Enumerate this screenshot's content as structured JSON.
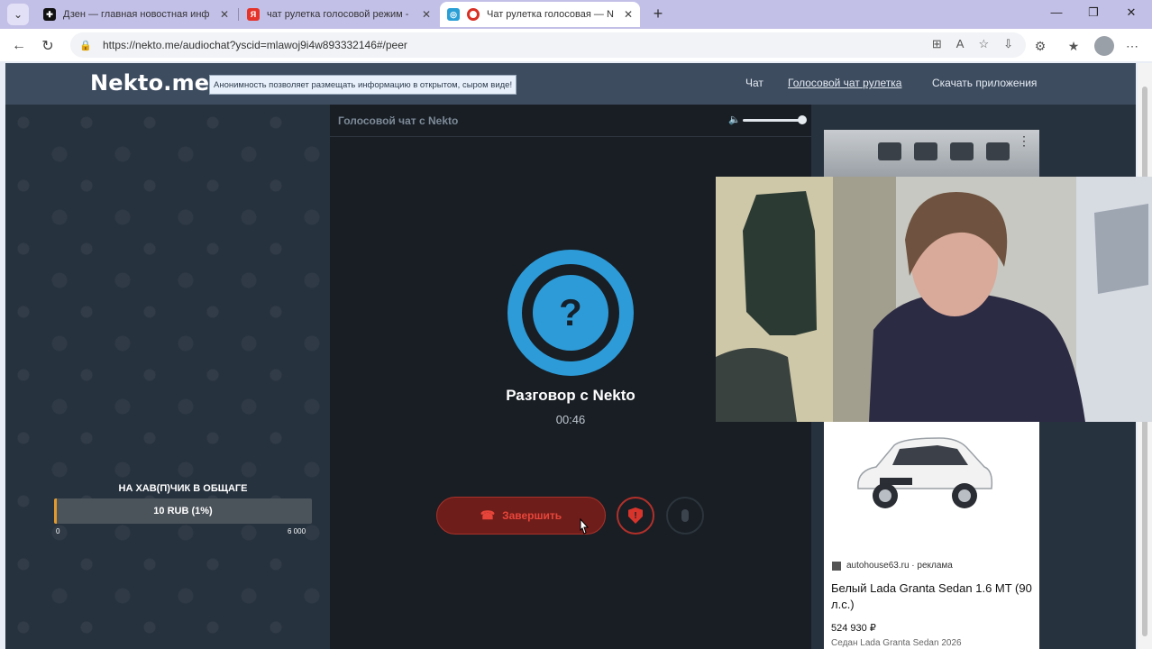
{
  "browser": {
    "tabs": [
      {
        "title": "Дзен — главная новостная инф",
        "favicon": "zen-icon",
        "active": false
      },
      {
        "title": "чат рулетка голосовой режим -",
        "favicon": "yandex-icon",
        "active": false
      },
      {
        "title": "Чат рулетка голосовая — N",
        "favicon": "record-icon",
        "active": true
      }
    ],
    "url": "https://nekto.me/audiochat?yscid=mlawoj9i4w893332146#/peer"
  },
  "site": {
    "logo": "Nekto.me",
    "tagline": "Анонимность позволяет размещать информацию в открытом, сыром виде!",
    "nav": [
      {
        "label": "Чат"
      },
      {
        "label": "Голосовой чат рулетка"
      },
      {
        "label": "Скачать приложения"
      }
    ]
  },
  "campaign": {
    "title": "НА ХАВ(П)ЧИК В ОБЩАГЕ",
    "progress_label": "10 RUB (1%)",
    "progress_fraction": 0.01,
    "min": "0",
    "max": "6 000"
  },
  "chat": {
    "header": "Голосовой чат с Nekto",
    "avatar_symbol": "?",
    "peer_name": "Разговор с Nekto",
    "timer": "00:46",
    "hangup_label": "Завершить",
    "volume_fraction": 1.0
  },
  "ad": {
    "source": "autohouse63.ru · реклама",
    "title": "Белый Lada Granta Sedan 1.6 MT (90 л.с.)",
    "price": "524 930 ₽",
    "subtitle": "Седан Lada Granta Sedan 2026"
  },
  "colors": {
    "accent_blue": "#2d9bd8",
    "danger_red": "#d7342c",
    "progress_orange": "#e39a2a",
    "header_bg": "#3e4c60"
  }
}
